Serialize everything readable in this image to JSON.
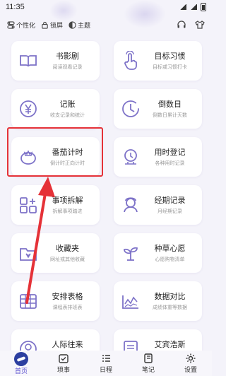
{
  "status_bar": {
    "time": "11:35"
  },
  "top_bar": {
    "personalize_label": "个性化",
    "lock_label": "锁屏",
    "theme_label": "主题"
  },
  "cards": [
    {
      "id": "drama",
      "title": "书影剧",
      "subtitle": "阅读观看记录",
      "icon": "open-book-icon"
    },
    {
      "id": "habit",
      "title": "目标习惯",
      "subtitle": "目标或习惯打卡",
      "icon": "tap-hand-icon"
    },
    {
      "id": "accounting",
      "title": "记账",
      "subtitle": "收支记录和统计",
      "icon": "yen-coin-icon"
    },
    {
      "id": "countdown",
      "title": "倒数日",
      "subtitle": "倒数日累计天数",
      "icon": "clock-icon"
    },
    {
      "id": "pomodoro",
      "title": "番茄计时",
      "subtitle": "倒计时正向计时",
      "icon": "tomato-icon"
    },
    {
      "id": "time-log",
      "title": "用时登记",
      "subtitle": "各种用时记录",
      "icon": "timer-icon"
    },
    {
      "id": "task-split",
      "title": "事项拆解",
      "subtitle": "拆解事项踏进",
      "icon": "blocks-icon"
    },
    {
      "id": "period",
      "title": "经期记录",
      "subtitle": "月经期记录",
      "icon": "person-icon"
    },
    {
      "id": "favorites",
      "title": "收藏夹",
      "subtitle": "网址或其他收藏",
      "icon": "folder-icon"
    },
    {
      "id": "wishlist",
      "title": "种草心愿",
      "subtitle": "心愿购物清单",
      "icon": "sprout-icon"
    },
    {
      "id": "schedule-table",
      "title": "安排表格",
      "subtitle": "课程表排班表",
      "icon": "table-icon"
    },
    {
      "id": "data-compare",
      "title": "数据对比",
      "subtitle": "成绩体重等数据",
      "icon": "chart-wave-icon"
    },
    {
      "id": "contacts",
      "title": "人际往来",
      "subtitle": "",
      "icon": "contacts-icon"
    },
    {
      "id": "aibinghaus",
      "title": "艾宾浩斯",
      "subtitle": "",
      "icon": "book-note-icon"
    }
  ],
  "bottom_nav": [
    {
      "label": "首页",
      "icon": "home-icon",
      "active": true
    },
    {
      "label": "琐事",
      "icon": "checkbox-icon",
      "active": false
    },
    {
      "label": "日程",
      "icon": "list-icon",
      "active": false
    },
    {
      "label": "笔记",
      "icon": "notebook-icon",
      "active": false
    },
    {
      "label": "设置",
      "icon": "gear-icon",
      "active": false
    }
  ],
  "colors": {
    "accent": "#5a4fcf",
    "icon_stroke": "#7d72c8",
    "annotation_red": "#e53238",
    "background": "#f4f3fa"
  }
}
